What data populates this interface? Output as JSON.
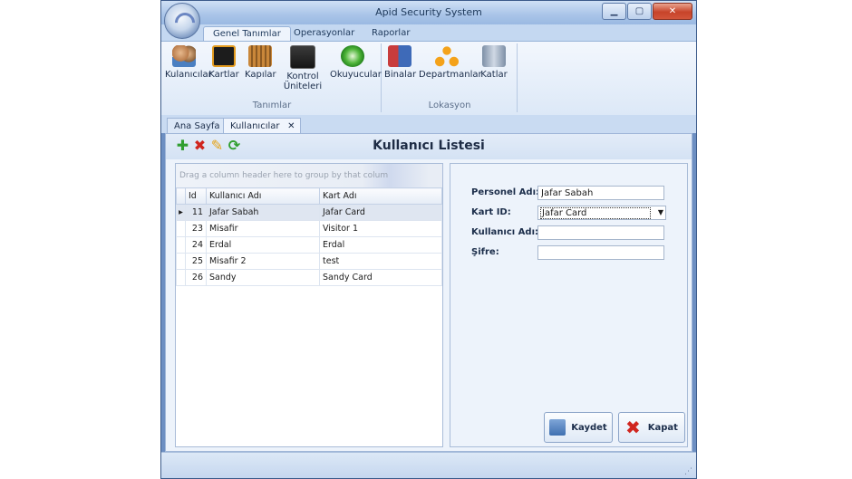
{
  "window": {
    "title": "Apid Security System",
    "accent": "#6d8fc2"
  },
  "ribbon_tabs": [
    "Genel Tanımlar",
    "Operasyonlar",
    "Raporlar"
  ],
  "groups": {
    "tanimlar": {
      "label": "Tanımlar",
      "items": [
        "Kulanıcılar",
        "Kartlar",
        "Kapılar",
        "Kontrol Üniteleri",
        "Okuyucular"
      ]
    },
    "lokasyon": {
      "label": "Lokasyon",
      "items": [
        "Binalar",
        "Departmanlar",
        "Katlar"
      ]
    }
  },
  "doc_tabs": [
    "Ana Sayfa",
    "Kullanıcılar"
  ],
  "panel_title": "Kullanıcı Listesi",
  "grid": {
    "group_hint": "Drag a column header here to group by that colum",
    "columns": [
      "Id",
      "Kullanıcı Adı",
      "Kart Adı"
    ],
    "rows": [
      {
        "id": "11",
        "user": "Jafar Sabah",
        "card": "Jafar Card"
      },
      {
        "id": "23",
        "user": "Misafir",
        "card": "Visitor 1"
      },
      {
        "id": "24",
        "user": "Erdal",
        "card": "Erdal"
      },
      {
        "id": "25",
        "user": "Misafir 2",
        "card": "test"
      },
      {
        "id": "26",
        "user": "Sandy",
        "card": "Sandy Card"
      }
    ]
  },
  "form": {
    "personel_label": "Personel Adı:",
    "personel_value": "Jafar Sabah",
    "kart_label": "Kart ID:",
    "kart_value": "Jafar Card",
    "kullanici_label": "Kullanıcı Adı:",
    "kullanici_value": "",
    "sifre_label": "Şifre:",
    "sifre_value": ""
  },
  "buttons": {
    "save": "Kaydet",
    "close": "Kapat"
  }
}
